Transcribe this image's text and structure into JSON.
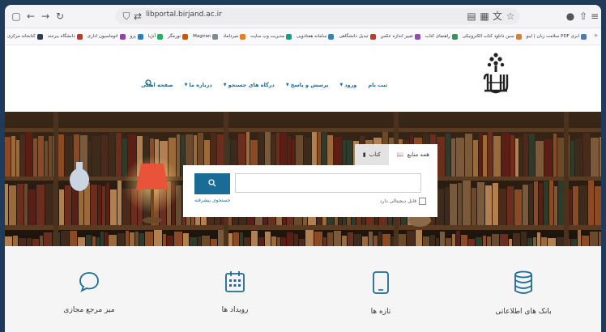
{
  "browser": {
    "url": "libportal.birjand.ac.ir",
    "bookmarks": [
      "سلامت زبان | ایبو PDF ابری",
      "سین دانلود کتاب الکترونیکی",
      "راهنمای کتاب",
      "تغییر اندازه عکس",
      "تبدیل دانشگاهی",
      "سامانه هفتادویی",
      "مدیریت وب سایت",
      "میرداماد",
      "Magiran",
      "نورمگز",
      "آنژیا",
      "پرو",
      "اتوماسیون اداری",
      "دانشگاه بیرجند",
      "کتابخانه مرکزی"
    ]
  },
  "site": {
    "nav": {
      "home": "صفحه اصلی",
      "about": "درباره ما",
      "portals": "درگاه های جستجو",
      "qa": "پرسش و پاسخ",
      "login": "ورود",
      "register": "ثبت نام"
    },
    "search": {
      "tab_all": "همه منابع",
      "tab_book": "کتاب",
      "advanced": "جستجوی پیشرفته",
      "digital": "قابل دیجیتالی دارد"
    },
    "services": [
      {
        "label": "بانک های اطلاعاتی",
        "icon": "database-icon"
      },
      {
        "label": "تازه ها",
        "icon": "tablet-icon"
      },
      {
        "label": "رویداد ها",
        "icon": "calendar-icon"
      },
      {
        "label": "میز مرجع مجازی",
        "icon": "chat-bubble-icon"
      }
    ]
  },
  "colors": {
    "accent": "#1a6c96",
    "frame": "#1f3b5c"
  }
}
